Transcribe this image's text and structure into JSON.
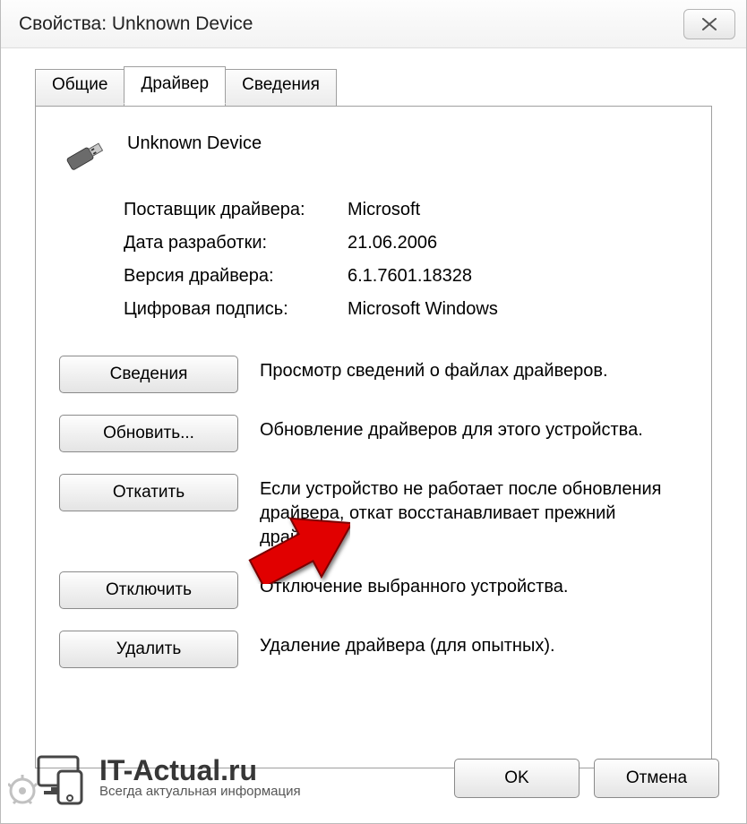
{
  "window": {
    "title": "Свойства: Unknown Device"
  },
  "tabs": {
    "general": "Общие",
    "driver": "Драйвер",
    "details": "Сведения"
  },
  "device": {
    "name": "Unknown Device"
  },
  "info": {
    "provider_label": "Поставщик драйвера:",
    "provider_value": "Microsoft",
    "date_label": "Дата разработки:",
    "date_value": "21.06.2006",
    "version_label": "Версия драйвера:",
    "version_value": "6.1.7601.18328",
    "signer_label": "Цифровая подпись:",
    "signer_value": "Microsoft Windows"
  },
  "actions": {
    "details": {
      "label": "Сведения",
      "desc": "Просмотр сведений о файлах драйверов."
    },
    "update": {
      "label": "Обновить...",
      "desc": "Обновление драйверов для этого устройства."
    },
    "rollback": {
      "label": "Откатить",
      "desc": "Если устройство не работает после обновления драйвера, откат восстанавливает прежний драйвер."
    },
    "disable": {
      "label": "Отключить",
      "desc": "Отключение выбранного устройства."
    },
    "uninstall": {
      "label": "Удалить",
      "desc": "Удаление драйвера (для опытных)."
    }
  },
  "footer": {
    "ok": "OK",
    "cancel": "Отмена"
  },
  "watermark": {
    "title": "IT-Actual.ru",
    "subtitle": "Всегда актуальная информация"
  }
}
